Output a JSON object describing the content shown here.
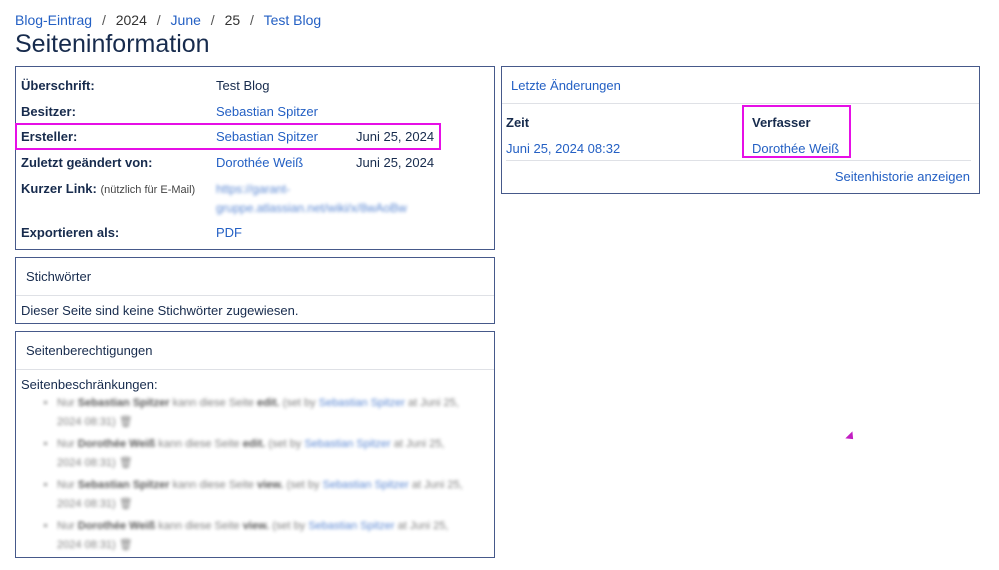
{
  "breadcrumb": {
    "items": [
      "Blog-Eintrag",
      "2024",
      "June",
      "25",
      "Test Blog"
    ],
    "separator": "/"
  },
  "page_title": "Seiteninformation",
  "info": {
    "title_label": "Überschrift:",
    "title_value": "Test Blog",
    "owner_label": "Besitzer:",
    "owner_value": "Sebastian Spitzer",
    "creator_label": "Ersteller:",
    "creator_value": "Sebastian Spitzer",
    "creator_date": "Juni 25, 2024",
    "modified_label": "Zuletzt geändert von:",
    "modified_value": "Dorothée Weiß",
    "modified_date": "Juni 25, 2024",
    "shortlink_label": "Kurzer Link:",
    "shortlink_hint": "(nützlich für E-Mail)",
    "shortlink_line1": "https://garant-",
    "shortlink_line2": "gruppe.atlassian.net/wiki/x/8wAoBw",
    "export_label": "Exportieren als:",
    "export_value": "PDF"
  },
  "changes": {
    "heading": "Letzte Änderungen",
    "col_time": "Zeit",
    "col_author": "Verfasser",
    "time_value": "Juni 25, 2024 08:32",
    "author_value": "Dorothée Weiß",
    "history_link": "Seitenhistorie anzeigen"
  },
  "keywords": {
    "heading": "Stichwörter",
    "text": "Dieser Seite sind keine Stichwörter zugewiesen."
  },
  "permissions": {
    "heading": "Seitenberechtigungen",
    "subheading": "Seitenbeschränkungen:",
    "items": [
      {
        "pre": "Nur",
        "user": "Sebastian Spitzer",
        "mid": "kann diese Seite",
        "perm": "edit.",
        "set_pre": "(set by",
        "set_by": "Sebastian Spitzer",
        "set_post": "at Juni 25, 2024 08:31)"
      },
      {
        "pre": "Nur",
        "user": "Dorothée Weiß",
        "mid": "kann diese Seite",
        "perm": "edit.",
        "set_pre": "(set by",
        "set_by": "Sebastian Spitzer",
        "set_post": "at Juni 25, 2024 08:31)"
      },
      {
        "pre": "Nur",
        "user": "Sebastian Spitzer",
        "mid": "kann diese Seite",
        "perm": "view.",
        "set_pre": "(set by",
        "set_by": "Sebastian Spitzer",
        "set_post": "at Juni 25, 2024 08:31)"
      },
      {
        "pre": "Nur",
        "user": "Dorothée Weiß",
        "mid": "kann diese Seite",
        "perm": "view.",
        "set_pre": "(set by",
        "set_by": "Sebastian Spitzer",
        "set_post": "at Juni 25, 2024 08:31)"
      }
    ]
  },
  "colors": {
    "link": "#2460c4",
    "highlight": "#e60fe6",
    "panel_border": "#46598a"
  }
}
